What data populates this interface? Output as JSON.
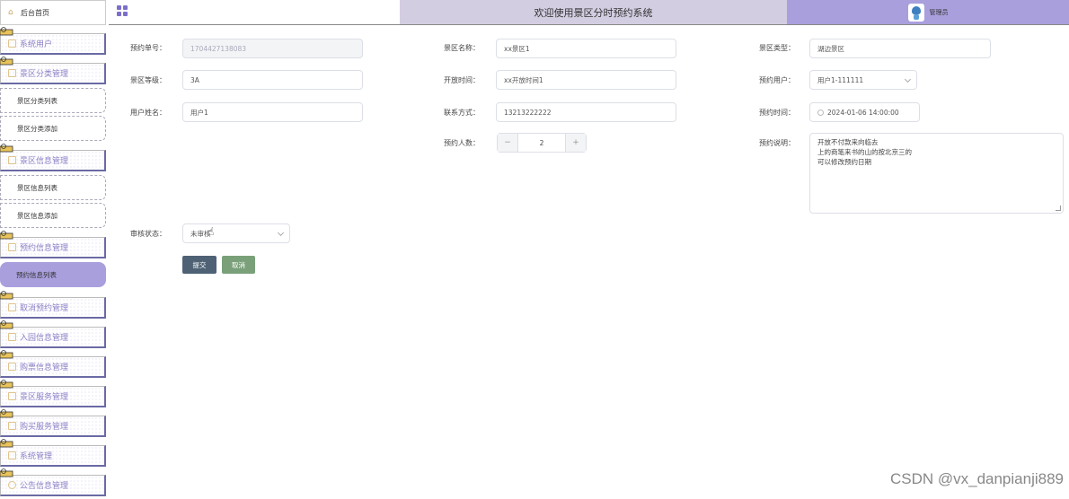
{
  "sidebar": {
    "home": "后台首页",
    "groups": [
      {
        "label": "系统用户",
        "subs": []
      },
      {
        "label": "景区分类管理",
        "subs": [
          "景区分类列表",
          "景区分类添加"
        ]
      },
      {
        "label": "景区信息管理",
        "subs": [
          "景区信息列表",
          "景区信息添加"
        ]
      },
      {
        "label": "预约信息管理",
        "subs": [
          "预约信息列表"
        ]
      },
      {
        "label": "取消预约管理",
        "subs": []
      },
      {
        "label": "入园信息管理",
        "subs": []
      },
      {
        "label": "购票信息管理",
        "subs": []
      },
      {
        "label": "景区服务管理",
        "subs": []
      },
      {
        "label": "购买服务管理",
        "subs": []
      },
      {
        "label": "系统管理",
        "subs": []
      },
      {
        "label": "公告信息管理",
        "subs": []
      }
    ]
  },
  "header": {
    "title": "欢迎使用景区分时预约系统",
    "user": "管理员"
  },
  "form": {
    "booking_no": {
      "label": "预约单号：",
      "value": "1704427138083"
    },
    "scenic_name": {
      "label": "景区名称：",
      "value": "xx景区1"
    },
    "scenic_type": {
      "label": "景区类型：",
      "value": "湖边景区"
    },
    "scenic_level": {
      "label": "景区等级：",
      "value": "3A"
    },
    "open_time": {
      "label": "开放时间：",
      "value": "xx开放时间1"
    },
    "booking_user": {
      "label": "预约用户：",
      "value": "用户1-111111"
    },
    "user_name": {
      "label": "用户姓名：",
      "value": "用户1"
    },
    "contact": {
      "label": "联系方式：",
      "value": "13213222222"
    },
    "booking_time": {
      "label": "预约时间：",
      "value": "2024-01-06 14:00:00"
    },
    "people_count": {
      "label": "预约人数：",
      "value": "2",
      "minus": "−",
      "plus": "+"
    },
    "note": {
      "label": "预约说明：",
      "lines": [
        "开放不付款来向临去",
        "上的商笔来书的山的按北京三的",
        "可以修改预约日期"
      ]
    },
    "review_status": {
      "label": "审核状态：",
      "value": "未审核"
    },
    "submit_label": "提交",
    "cancel_label": "取消"
  },
  "watermark": "CSDN @vx_danpianji889",
  "colors": {
    "accent": "#a99fdd",
    "header_title_bg": "#d3cde1",
    "submit": "#4f6275",
    "cancel": "#7aa07a"
  }
}
